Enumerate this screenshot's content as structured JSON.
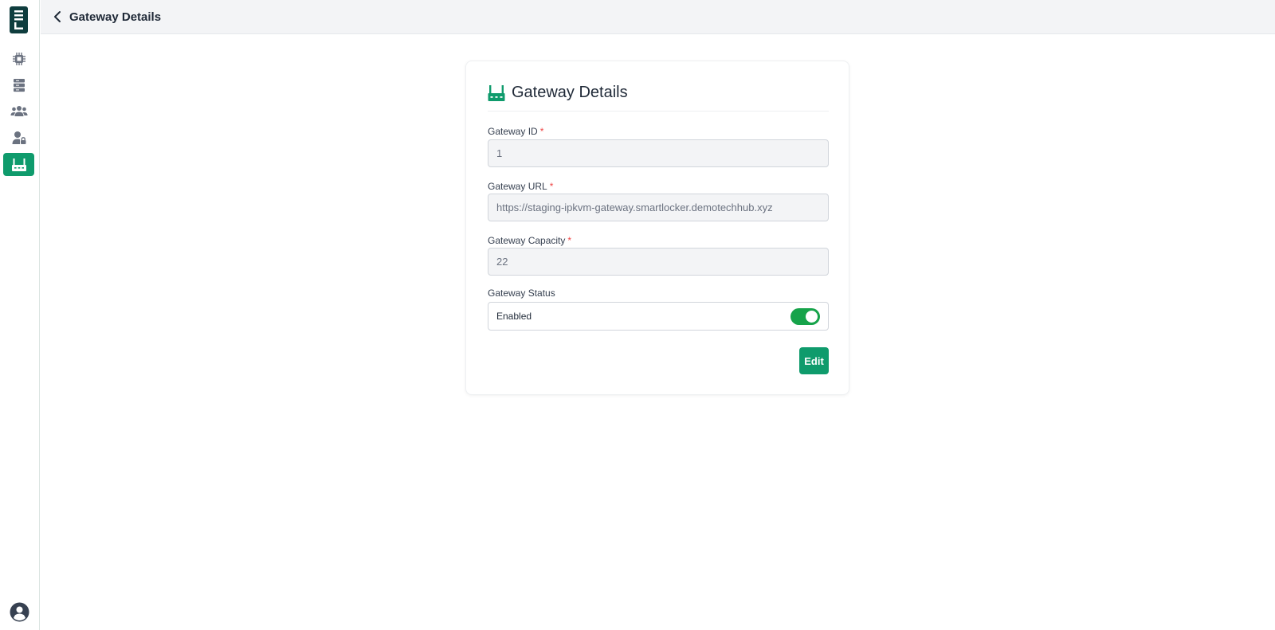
{
  "sidebar": {
    "items": [
      {
        "name": "chip-icon",
        "active": false
      },
      {
        "name": "server-icon",
        "active": false
      },
      {
        "name": "users-icon",
        "active": false
      },
      {
        "name": "user-lock-icon",
        "active": false
      },
      {
        "name": "gateway-icon",
        "active": true
      }
    ],
    "profile_icon": "user-circle-icon"
  },
  "topbar": {
    "title": "Gateway Details",
    "back_icon": "chevron-left-icon"
  },
  "card": {
    "title": "Gateway Details",
    "icon": "gateway-icon",
    "fields": {
      "gateway_id": {
        "label": "Gateway ID",
        "required": "*",
        "value": "1"
      },
      "gateway_url": {
        "label": "Gateway URL",
        "required": "*",
        "value": "https://staging-ipkvm-gateway.smartlocker.demotechhub.xyz"
      },
      "gateway_capacity": {
        "label": "Gateway Capacity",
        "required": "*",
        "value": "22"
      },
      "gateway_status": {
        "label": "Gateway Status",
        "value": "Enabled",
        "toggle_on": true
      }
    },
    "edit_label": "Edit"
  },
  "colors": {
    "accent": "#0f9b6c",
    "toggle_on": "#16a34a",
    "required": "#ef4444",
    "logo_bg": "#0f3d3e"
  }
}
